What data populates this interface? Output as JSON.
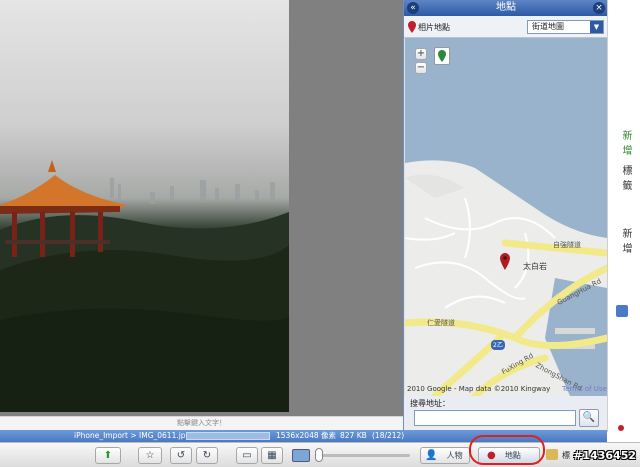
{
  "viewer": {
    "caption": "點擊鍵入文字！"
  },
  "status": {
    "path": "iPhone_Import > IMG_0611.jpg",
    "dims": "1536x2048 像素",
    "size": "827 KB",
    "count": "(18/212)"
  },
  "map_panel": {
    "title": "地點",
    "photo_location_label": "相片地點",
    "map_type": "街道地圖",
    "zoom_in": "+",
    "zoom_out": "−",
    "address_label": "搜尋地址：",
    "address_value": "",
    "labels": {
      "place": "太白岩",
      "road1": "自強隧道",
      "road2": "GuangHua Rd",
      "road3": "仁愛隧道",
      "road4": "FuXing Rd",
      "road5": "ZhongShan Rd",
      "shield": "2乙",
      "attribution": "2010 Google - Map data ©2010 Kingway",
      "terms": "Terms of Use"
    }
  },
  "right_strip": {
    "t1": "新",
    "t2": "增",
    "t3": "標",
    "t4": "籤",
    "t5": "新",
    "t6": "增"
  },
  "toolbar": {
    "people_label": "人物",
    "places_label": "地點",
    "tags_label": "標",
    "watermark": "#1436452"
  },
  "icons": [
    "up-arrow-icon",
    "star-icon",
    "rotate-left-icon",
    "rotate-right-icon",
    "single-view-icon",
    "grid-view-icon",
    "landscape-icon",
    "person-icon",
    "map-pin-icon",
    "tag-icon",
    "search-icon"
  ],
  "colors": {
    "titlebar": "#3b66b0",
    "statusbar": "#5b8acb",
    "highlight": "#e02020",
    "land": "#ececea",
    "road": "#f2e98a"
  }
}
